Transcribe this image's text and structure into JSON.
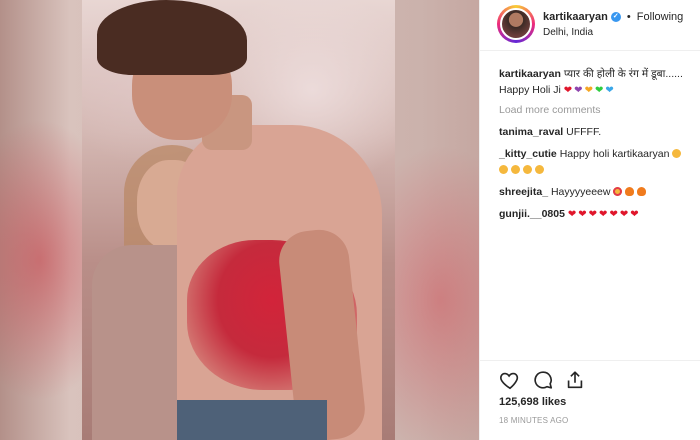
{
  "post": {
    "username": "kartikaaryan",
    "follow_label": "Following",
    "location": "Delhi, India"
  },
  "caption": {
    "user": "kartikaaryan",
    "text_line1": "प्यार की होली के रंग में डूबा......",
    "text_line2": "Happy Holi Ji",
    "emoji_colors": [
      "#e0162b",
      "#8e44ad",
      "#f5a623",
      "#2ecc40",
      "#3aa7e8"
    ]
  },
  "load_more_label": "Load more comments",
  "comments": [
    {
      "user": "tanima_raval",
      "text": "UFFFF."
    },
    {
      "user": "_kitty_cutie",
      "text": "Happy holi kartikaaryan"
    },
    {
      "user": "shreejita_",
      "text": "Hayyyyeeew"
    },
    {
      "user": "gunjii.__0805",
      "text": ""
    }
  ],
  "likes": "125,698 likes",
  "timestamp": "18 MINUTES AGO",
  "icons": [
    "heart-icon",
    "comment-icon",
    "share-icon",
    "verified-icon"
  ],
  "colors": {
    "accent": "#3897f0",
    "muted": "#999999",
    "heart": "#e0162b"
  }
}
